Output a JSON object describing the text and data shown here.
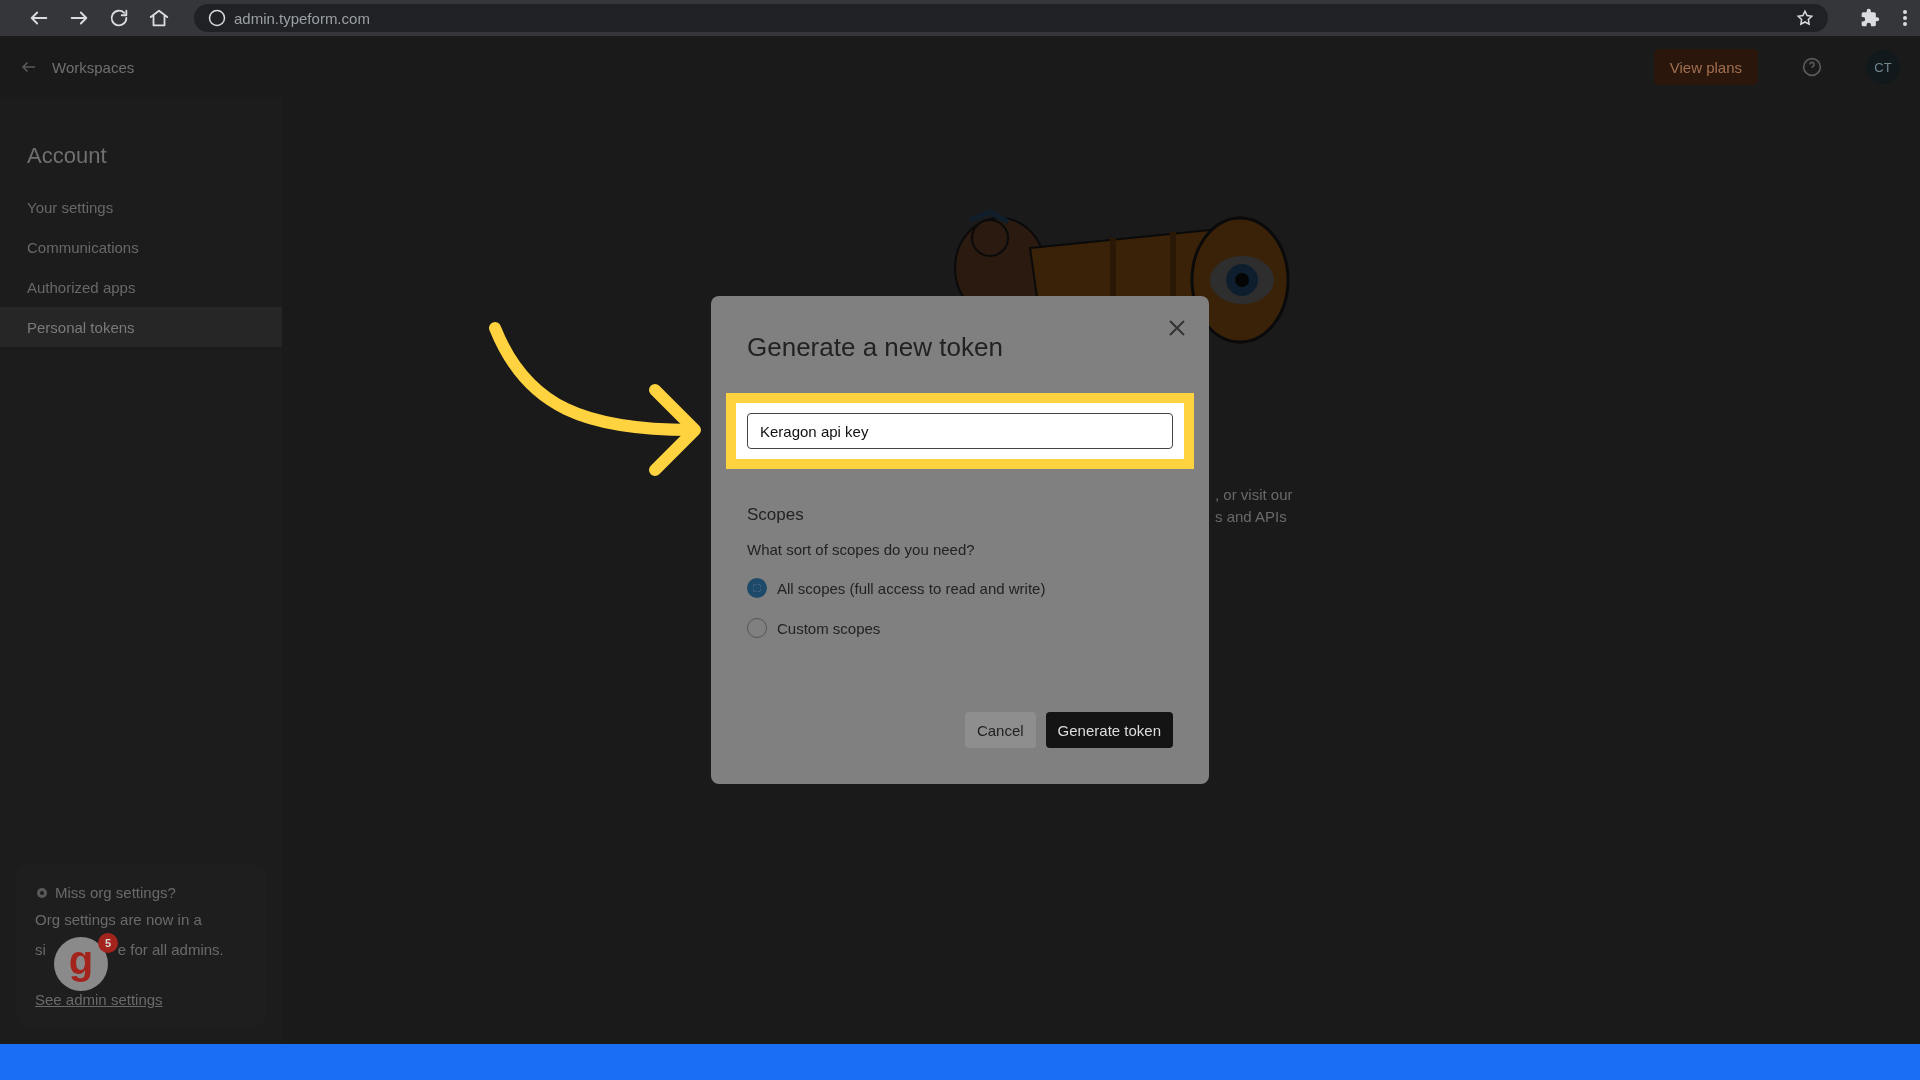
{
  "browser": {
    "url": "admin.typeform.com"
  },
  "header": {
    "back_label": "Workspaces",
    "plan_button": "View plans",
    "avatar": "CT"
  },
  "sidebar": {
    "heading": "Account",
    "items": [
      {
        "label": "Your settings",
        "selected": false
      },
      {
        "label": "Communications",
        "selected": false
      },
      {
        "label": "Authorized apps",
        "selected": false
      },
      {
        "label": "Personal tokens",
        "selected": true
      }
    ]
  },
  "org_note": {
    "title": "Miss org settings?",
    "line1": "Org settings are now in a",
    "line2_parts": [
      "si",
      "e for all admins."
    ],
    "link": "See admin settings"
  },
  "support_widget": {
    "logo_text": "g",
    "badge": "5"
  },
  "background_text": [
    ", or visit our",
    "s and APIs"
  ],
  "modal": {
    "title": "Generate a new token",
    "name_value": "Keragon api key",
    "scopes_heading": "Scopes",
    "scopes_question": "What sort of scopes do you need?",
    "options": [
      {
        "label": "All scopes (full access to read and write)",
        "selected": true
      },
      {
        "label": "Custom scopes",
        "selected": false
      }
    ],
    "buttons": [
      {
        "label": "Cancel",
        "kind": "secondary"
      },
      {
        "label": "Generate token",
        "kind": "primary"
      }
    ]
  }
}
